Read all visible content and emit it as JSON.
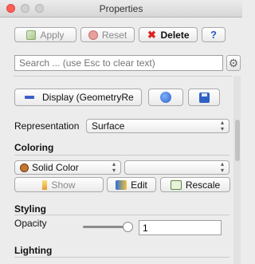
{
  "window": {
    "title": "Properties"
  },
  "toolbar": {
    "apply": "Apply",
    "reset": "Reset",
    "delete": "Delete",
    "help": "?"
  },
  "search": {
    "placeholder": "Search ... (use Esc to clear text)"
  },
  "display": {
    "label": "Display (GeometryRe"
  },
  "representation": {
    "label": "Representation",
    "value": "Surface"
  },
  "coloring": {
    "section": "Coloring",
    "mode": "Solid Color",
    "array": "",
    "show": "Show",
    "edit": "Edit",
    "rescale": "Rescale"
  },
  "styling": {
    "section": "Styling",
    "opacity_label": "Opacity",
    "opacity_value": "1",
    "opacity_slider": 1.0
  },
  "lighting": {
    "section": "Lighting"
  },
  "colors": {
    "close": "#ff5f57",
    "solid_color": "#c8762f",
    "delete_x": "#dd2222",
    "help": "#2a56c6"
  }
}
